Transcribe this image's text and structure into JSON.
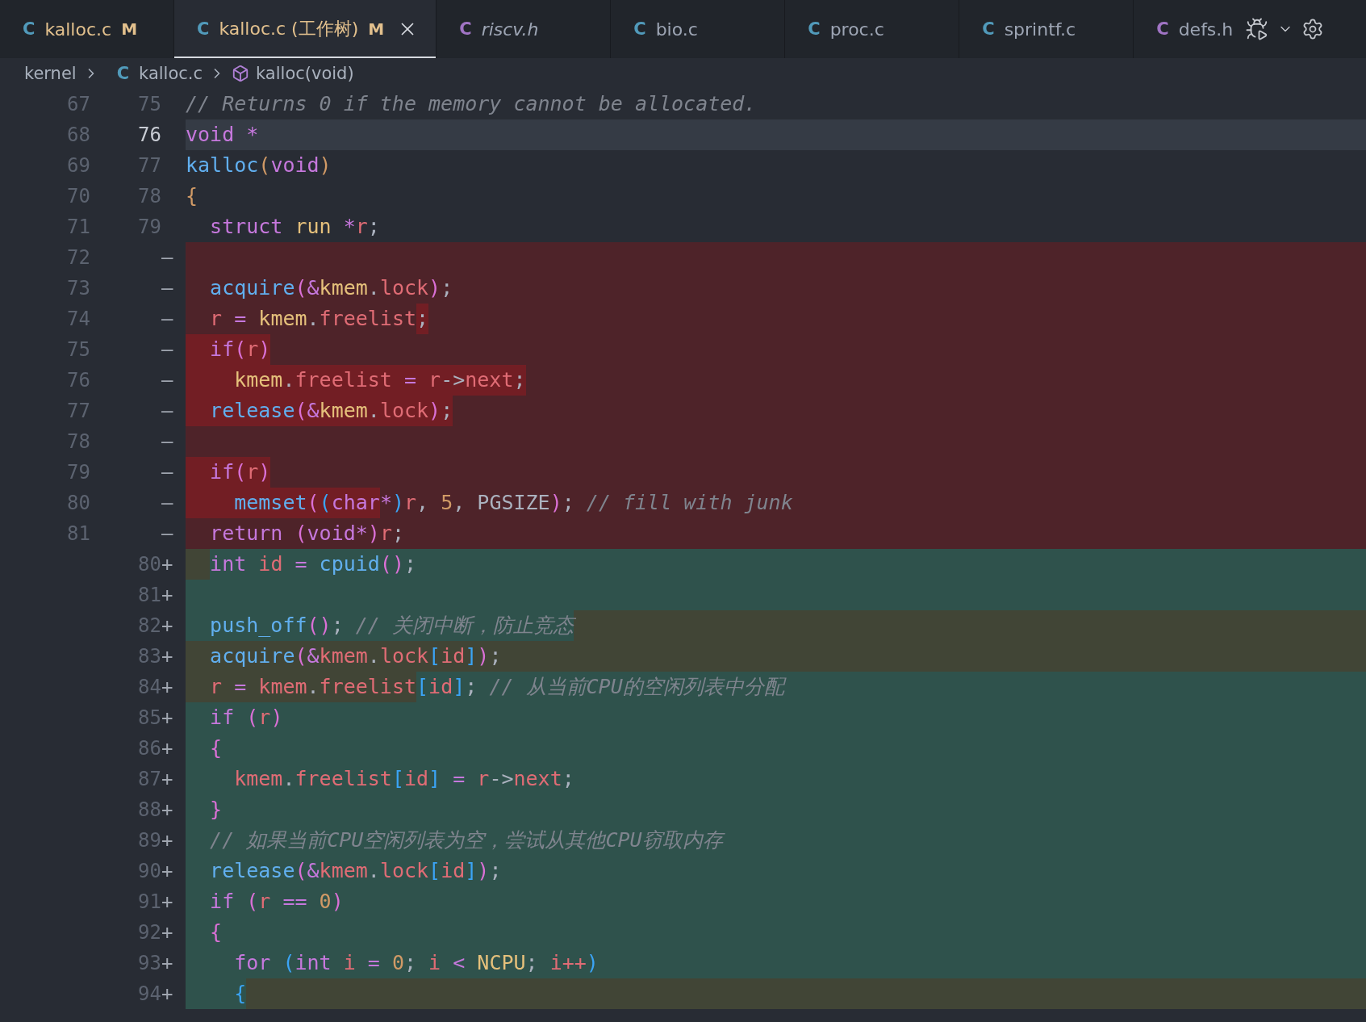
{
  "tabs": [
    {
      "icon": "C",
      "color": "#519aba",
      "label": "kalloc.c",
      "status": "M",
      "modified": true,
      "preview": false,
      "selected": false
    },
    {
      "icon": "C",
      "color": "#519aba",
      "label": "kalloc.c (工作树)",
      "status": "M",
      "modified": true,
      "preview": false,
      "selected": true
    },
    {
      "icon": "C",
      "color": "#a074c4",
      "label": "riscv.h",
      "modified": false,
      "preview": true,
      "selected": false
    },
    {
      "icon": "C",
      "color": "#519aba",
      "label": "bio.c",
      "modified": false,
      "preview": false,
      "selected": false
    },
    {
      "icon": "C",
      "color": "#519aba",
      "label": "proc.c",
      "modified": false,
      "preview": false,
      "selected": false
    },
    {
      "icon": "C",
      "color": "#519aba",
      "label": "sprintf.c",
      "modified": false,
      "preview": false,
      "selected": false
    },
    {
      "icon": "C",
      "color": "#a074c4",
      "label": "defs.h",
      "modified": false,
      "preview": false,
      "selected": false
    }
  ],
  "breadcrumb": {
    "folder": "kernel",
    "file_icon": "C",
    "file": "kalloc.c",
    "symbol": "kalloc(void)"
  },
  "lines": [
    {
      "old": "67",
      "new": "75",
      "kind": "context",
      "current": false,
      "tokens": [
        {
          "text": "// Returns 0 if the memory cannot be allocated.",
          "kind": "comment"
        }
      ]
    },
    {
      "old": "68",
      "new": "76",
      "kind": "context",
      "current": true,
      "tokens": [
        {
          "text": "void ",
          "kind": "keyword"
        },
        {
          "text": "*",
          "kind": "operator"
        }
      ]
    },
    {
      "old": "69",
      "new": "77",
      "kind": "context",
      "current": false,
      "tokens": [
        {
          "text": "kalloc",
          "kind": "function"
        },
        {
          "text": "(",
          "kind": "bracket1"
        },
        {
          "text": "void",
          "kind": "keyword"
        },
        {
          "text": ")",
          "kind": "bracket1"
        }
      ]
    },
    {
      "old": "70",
      "new": "78",
      "kind": "context",
      "current": false,
      "tokens": [
        {
          "text": "{",
          "kind": "bracket1"
        }
      ]
    },
    {
      "old": "71",
      "new": "79",
      "kind": "context",
      "current": false,
      "tokens": [
        {
          "text": "  struct ",
          "kind": "keyword"
        },
        {
          "text": "run ",
          "kind": "type"
        },
        {
          "text": "*",
          "kind": "operator"
        },
        {
          "text": "r",
          "kind": "variable"
        },
        {
          "text": ";",
          "kind": "plain"
        }
      ]
    },
    {
      "old": "72",
      "marker": "—",
      "kind": "removed",
      "current": false,
      "changed_to_end": false
    },
    {
      "old": "73",
      "marker": "—",
      "kind": "removed",
      "current": false,
      "indent_changed": false,
      "changed_to_end": false,
      "tokens": [
        {
          "text": "  acquire",
          "kind": "function",
          "changed": false
        },
        {
          "text": "(",
          "kind": "bracket2",
          "changed": false
        },
        {
          "text": "&",
          "kind": "operator",
          "changed": false
        },
        {
          "text": "kmem",
          "kind": "object",
          "changed": false
        },
        {
          "text": ".",
          "kind": "plain",
          "changed": false
        },
        {
          "text": "lock",
          "kind": "member",
          "changed": false
        },
        {
          "text": ")",
          "kind": "bracket2",
          "changed": false
        },
        {
          "text": ";",
          "kind": "plain",
          "changed": false
        }
      ]
    },
    {
      "old": "74",
      "marker": "—",
      "kind": "removed",
      "current": false,
      "indent_changed": false,
      "changed_to_end": false,
      "tokens": [
        {
          "text": "  r ",
          "kind": "variable",
          "changed": false
        },
        {
          "text": "= ",
          "kind": "operator",
          "changed": false
        },
        {
          "text": "kmem",
          "kind": "object",
          "changed": false
        },
        {
          "text": ".",
          "kind": "plain",
          "changed": false
        },
        {
          "text": "freelist",
          "kind": "member",
          "changed": false
        },
        {
          "text": ";",
          "kind": "plain",
          "changed": true
        }
      ]
    },
    {
      "old": "75",
      "marker": "—",
      "kind": "removed",
      "current": false,
      "indent_changed": true,
      "changed_to_end": false,
      "tokens": [
        {
          "text": "  if",
          "kind": "keyword",
          "changed": true
        },
        {
          "text": "(",
          "kind": "bracket2",
          "changed": true
        },
        {
          "text": "r",
          "kind": "variable",
          "changed": true
        },
        {
          "text": ")",
          "kind": "bracket2",
          "changed": true
        }
      ]
    },
    {
      "old": "76",
      "marker": "—",
      "kind": "removed",
      "current": false,
      "indent_changed": true,
      "changed_to_end": false,
      "tokens": [
        {
          "text": "    kmem",
          "kind": "object",
          "changed": true
        },
        {
          "text": ".",
          "kind": "plain",
          "changed": true
        },
        {
          "text": "freelist ",
          "kind": "member",
          "changed": true
        },
        {
          "text": "= ",
          "kind": "operator",
          "changed": true
        },
        {
          "text": "r",
          "kind": "variable",
          "changed": true
        },
        {
          "text": "->",
          "kind": "plain",
          "changed": true
        },
        {
          "text": "next",
          "kind": "member",
          "changed": true
        },
        {
          "text": ";",
          "kind": "plain",
          "changed": true
        }
      ]
    },
    {
      "old": "77",
      "marker": "—",
      "kind": "removed",
      "current": false,
      "indent_changed": true,
      "changed_to_end": false,
      "tokens": [
        {
          "text": "  release",
          "kind": "function",
          "changed": true
        },
        {
          "text": "(",
          "kind": "bracket2",
          "changed": true
        },
        {
          "text": "&",
          "kind": "operator",
          "changed": true
        },
        {
          "text": "kmem",
          "kind": "object",
          "changed": true
        },
        {
          "text": ".",
          "kind": "plain",
          "changed": true
        },
        {
          "text": "lock",
          "kind": "member",
          "changed": true
        },
        {
          "text": ")",
          "kind": "bracket2",
          "changed": true
        },
        {
          "text": ";",
          "kind": "plain",
          "changed": true
        }
      ]
    },
    {
      "old": "78",
      "marker": "—",
      "kind": "removed",
      "current": false,
      "changed_to_end": false
    },
    {
      "old": "79",
      "marker": "—",
      "kind": "removed",
      "current": false,
      "indent_changed": true,
      "changed_to_end": false,
      "tokens": [
        {
          "text": "  if",
          "kind": "keyword",
          "changed": true
        },
        {
          "text": "(",
          "kind": "bracket2",
          "changed": true
        },
        {
          "text": "r",
          "kind": "variable",
          "changed": true
        },
        {
          "text": ")",
          "kind": "bracket2",
          "changed": true
        }
      ]
    },
    {
      "old": "80",
      "marker": "—",
      "kind": "removed",
      "current": false,
      "indent_changed": true,
      "changed_to_end": false,
      "tokens": [
        {
          "text": "    memset",
          "kind": "function",
          "changed": true
        },
        {
          "text": "(",
          "kind": "bracket2",
          "changed": true
        },
        {
          "text": "(",
          "kind": "bracket3",
          "changed": true
        },
        {
          "text": "char",
          "kind": "keyword",
          "changed": true
        },
        {
          "text": "*",
          "kind": "operator",
          "changed": false
        },
        {
          "text": ")",
          "kind": "bracket3",
          "changed": false
        },
        {
          "text": "r",
          "kind": "variable",
          "changed": false
        },
        {
          "text": ", ",
          "kind": "plain",
          "changed": false
        },
        {
          "text": "5",
          "kind": "number",
          "changed": false
        },
        {
          "text": ", PGSIZE",
          "kind": "plain",
          "changed": false
        },
        {
          "text": ")",
          "kind": "bracket2",
          "changed": false
        },
        {
          "text": "; ",
          "kind": "plain",
          "changed": false
        },
        {
          "text": "// fill with junk",
          "kind": "comment",
          "changed": false
        }
      ]
    },
    {
      "old": "81",
      "marker": "—",
      "kind": "removed",
      "current": false,
      "indent_changed": false,
      "changed_to_end": false,
      "tokens": [
        {
          "text": "  return ",
          "kind": "keyword",
          "changed": false
        },
        {
          "text": "(",
          "kind": "bracket2",
          "changed": false
        },
        {
          "text": "void",
          "kind": "keyword",
          "changed": false
        },
        {
          "text": "*",
          "kind": "operator",
          "changed": false
        },
        {
          "text": ")",
          "kind": "bracket2",
          "changed": false
        },
        {
          "text": "r",
          "kind": "variable",
          "changed": false
        },
        {
          "text": ";",
          "kind": "plain",
          "changed": false
        }
      ]
    },
    {
      "new": "80",
      "marker": "+",
      "kind": "added",
      "current": false,
      "indent_changed": true,
      "changed_to_end": false,
      "tokens": [
        {
          "text": "  int ",
          "kind": "keyword",
          "changed": false
        },
        {
          "text": "id ",
          "kind": "variable",
          "changed": false
        },
        {
          "text": "= ",
          "kind": "operator",
          "changed": false
        },
        {
          "text": "cpuid",
          "kind": "function",
          "changed": false
        },
        {
          "text": "()",
          "kind": "bracket2",
          "changed": false
        },
        {
          "text": ";",
          "kind": "plain",
          "changed": false
        }
      ]
    },
    {
      "new": "81",
      "marker": "+",
      "kind": "added",
      "current": false,
      "changed_to_end": false
    },
    {
      "new": "82",
      "marker": "+",
      "kind": "added",
      "current": false,
      "indent_changed": false,
      "changed_to_end": true,
      "tokens": [
        {
          "text": "  push_off",
          "kind": "function",
          "changed": false
        },
        {
          "text": "()",
          "kind": "bracket2",
          "changed": false
        },
        {
          "text": "; ",
          "kind": "plain",
          "changed": false
        },
        {
          "text": "// 关闭中断，防止竞态",
          "kind": "comment",
          "changed": false
        }
      ]
    },
    {
      "new": "83",
      "marker": "+",
      "kind": "added",
      "current": false,
      "indent_changed": true,
      "changed_to_end": true,
      "tokens": [
        {
          "text": "  acquire",
          "kind": "function",
          "changed": true
        },
        {
          "text": "(",
          "kind": "bracket2",
          "changed": true
        },
        {
          "text": "&",
          "kind": "operator",
          "changed": true
        },
        {
          "text": "kmem",
          "kind": "variable",
          "changed": true
        },
        {
          "text": ".",
          "kind": "plain",
          "changed": true
        },
        {
          "text": "lock",
          "kind": "member",
          "changed": true
        },
        {
          "text": "[",
          "kind": "bracket3",
          "changed": true
        },
        {
          "text": "id",
          "kind": "variable",
          "changed": true
        },
        {
          "text": "]",
          "kind": "bracket3",
          "changed": true
        },
        {
          "text": ")",
          "kind": "bracket2",
          "changed": true
        },
        {
          "text": ";",
          "kind": "plain",
          "changed": true
        }
      ]
    },
    {
      "new": "84",
      "marker": "+",
      "kind": "added",
      "current": false,
      "indent_changed": true,
      "changed_to_end": false,
      "tokens": [
        {
          "text": "  r ",
          "kind": "variable",
          "changed": true
        },
        {
          "text": "= ",
          "kind": "operator",
          "changed": true
        },
        {
          "text": "kmem",
          "kind": "variable",
          "changed": true
        },
        {
          "text": ".",
          "kind": "plain",
          "changed": true
        },
        {
          "text": "freelist",
          "kind": "member",
          "changed": true
        },
        {
          "text": "[",
          "kind": "bracket3",
          "changed": false
        },
        {
          "text": "id",
          "kind": "variable",
          "changed": false
        },
        {
          "text": "]",
          "kind": "bracket3",
          "changed": false
        },
        {
          "text": "; ",
          "kind": "plain",
          "changed": false
        },
        {
          "text": "// 从当前CPU的空闲列表中分配",
          "kind": "comment",
          "changed": false
        }
      ]
    },
    {
      "new": "85",
      "marker": "+",
      "kind": "added",
      "current": false,
      "indent_changed": false,
      "changed_to_end": false,
      "tokens": [
        {
          "text": "  if ",
          "kind": "keyword",
          "changed": false
        },
        {
          "text": "(",
          "kind": "bracket2",
          "changed": false
        },
        {
          "text": "r",
          "kind": "variable",
          "changed": false
        },
        {
          "text": ")",
          "kind": "bracket2",
          "changed": false
        }
      ]
    },
    {
      "new": "86",
      "marker": "+",
      "kind": "added",
      "current": false,
      "indent_changed": false,
      "changed_to_end": false,
      "tokens": [
        {
          "text": "  {",
          "kind": "bracket2",
          "changed": false
        }
      ]
    },
    {
      "new": "87",
      "marker": "+",
      "kind": "added",
      "current": false,
      "indent_changed": false,
      "changed_to_end": false,
      "tokens": [
        {
          "text": "    kmem",
          "kind": "variable",
          "changed": false
        },
        {
          "text": ".",
          "kind": "plain",
          "changed": false
        },
        {
          "text": "freelist",
          "kind": "member",
          "changed": false
        },
        {
          "text": "[",
          "kind": "bracket3",
          "changed": false
        },
        {
          "text": "id",
          "kind": "variable",
          "changed": false
        },
        {
          "text": "] ",
          "kind": "bracket3",
          "changed": false
        },
        {
          "text": "= ",
          "kind": "operator",
          "changed": false
        },
        {
          "text": "r",
          "kind": "variable",
          "changed": false
        },
        {
          "text": "->",
          "kind": "plain",
          "changed": false
        },
        {
          "text": "next",
          "kind": "member",
          "changed": false
        },
        {
          "text": ";",
          "kind": "plain",
          "changed": false
        }
      ]
    },
    {
      "new": "88",
      "marker": "+",
      "kind": "added",
      "current": false,
      "indent_changed": false,
      "changed_to_end": false,
      "tokens": [
        {
          "text": "  }",
          "kind": "bracket2",
          "changed": false
        }
      ]
    },
    {
      "new": "89",
      "marker": "+",
      "kind": "added",
      "current": false,
      "indent_changed": false,
      "changed_to_end": false,
      "tokens": [
        {
          "text": "  // 如果当前CPU空闲列表为空，尝试从其他CPU窃取内存",
          "kind": "comment",
          "changed": false
        }
      ]
    },
    {
      "new": "90",
      "marker": "+",
      "kind": "added",
      "current": false,
      "indent_changed": false,
      "changed_to_end": false,
      "tokens": [
        {
          "text": "  release",
          "kind": "function",
          "changed": false
        },
        {
          "text": "(",
          "kind": "bracket2",
          "changed": false
        },
        {
          "text": "&",
          "kind": "operator",
          "changed": false
        },
        {
          "text": "kmem",
          "kind": "variable",
          "changed": false
        },
        {
          "text": ".",
          "kind": "plain",
          "changed": false
        },
        {
          "text": "lock",
          "kind": "member",
          "changed": false
        },
        {
          "text": "[",
          "kind": "bracket3",
          "changed": false
        },
        {
          "text": "id",
          "kind": "variable",
          "changed": false
        },
        {
          "text": "]",
          "kind": "bracket3",
          "changed": false
        },
        {
          "text": ")",
          "kind": "bracket2",
          "changed": false
        },
        {
          "text": ";",
          "kind": "plain",
          "changed": false
        }
      ]
    },
    {
      "new": "91",
      "marker": "+",
      "kind": "added",
      "current": false,
      "indent_changed": false,
      "changed_to_end": false,
      "tokens": [
        {
          "text": "  if ",
          "kind": "keyword",
          "changed": false
        },
        {
          "text": "(",
          "kind": "bracket2",
          "changed": false
        },
        {
          "text": "r ",
          "kind": "variable",
          "changed": false
        },
        {
          "text": "== ",
          "kind": "operator",
          "changed": false
        },
        {
          "text": "0",
          "kind": "number",
          "changed": false
        },
        {
          "text": ")",
          "kind": "bracket2",
          "changed": false
        }
      ]
    },
    {
      "new": "92",
      "marker": "+",
      "kind": "added",
      "current": false,
      "indent_changed": false,
      "changed_to_end": false,
      "tokens": [
        {
          "text": "  {",
          "kind": "bracket2",
          "changed": false
        }
      ]
    },
    {
      "new": "93",
      "marker": "+",
      "kind": "added",
      "current": false,
      "indent_changed": false,
      "changed_to_end": false,
      "tokens": [
        {
          "text": "    for ",
          "kind": "keyword",
          "changed": false
        },
        {
          "text": "(",
          "kind": "bracket3",
          "changed": false
        },
        {
          "text": "int ",
          "kind": "keyword",
          "changed": false
        },
        {
          "text": "i ",
          "kind": "variable",
          "changed": false
        },
        {
          "text": "= ",
          "kind": "operator",
          "changed": false
        },
        {
          "text": "0",
          "kind": "number",
          "changed": false
        },
        {
          "text": "; ",
          "kind": "plain",
          "changed": false
        },
        {
          "text": "i ",
          "kind": "variable",
          "changed": false
        },
        {
          "text": "< ",
          "kind": "operator",
          "changed": false
        },
        {
          "text": "NCPU",
          "kind": "object",
          "changed": false
        },
        {
          "text": "; ",
          "kind": "plain",
          "changed": false
        },
        {
          "text": "i++",
          "kind": "variable",
          "changed": false
        },
        {
          "text": ")",
          "kind": "bracket3",
          "changed": false
        }
      ]
    },
    {
      "new": "94",
      "marker": "+",
      "kind": "added",
      "current": false,
      "indent_changed": false,
      "changed_to_end": true,
      "tokens": [
        {
          "text": "    {",
          "kind": "bracket3",
          "changed": false
        }
      ]
    }
  ]
}
